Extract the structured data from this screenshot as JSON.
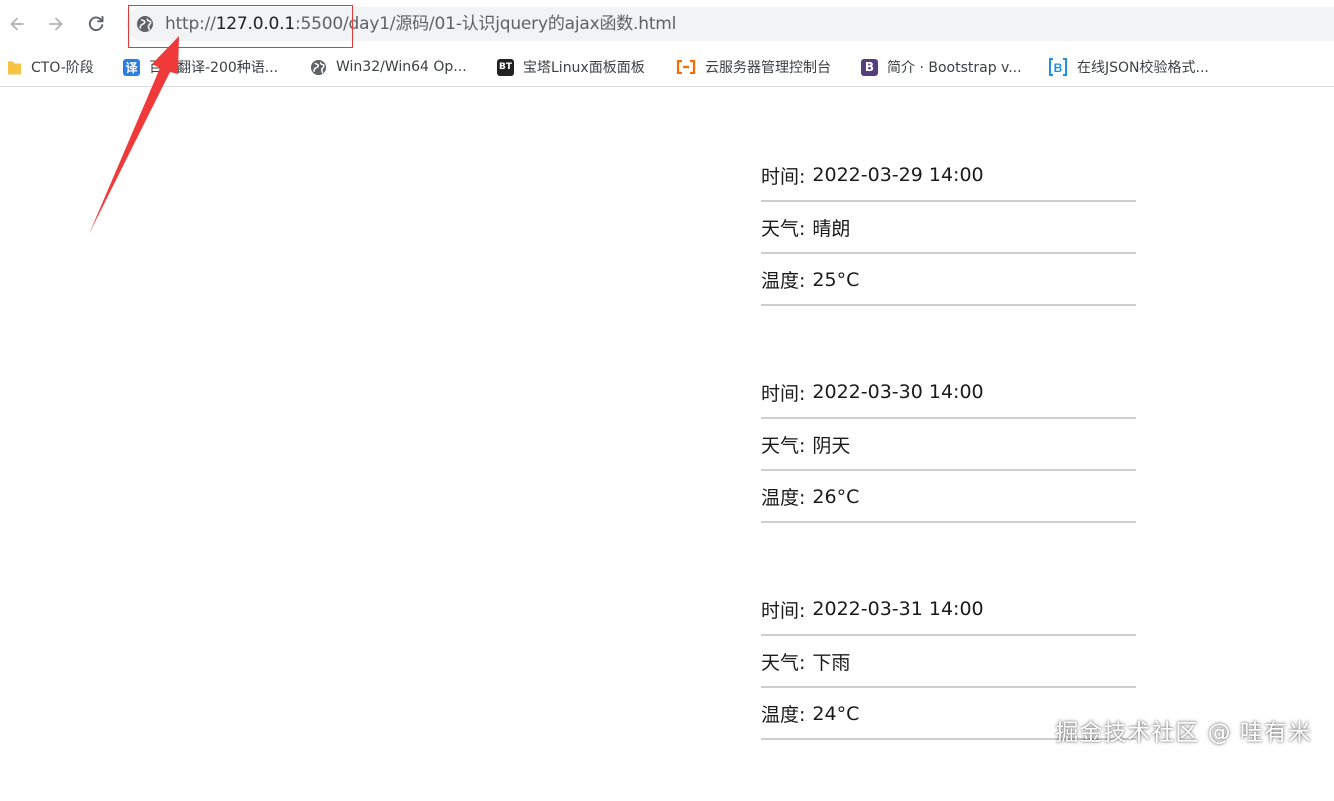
{
  "address_bar": {
    "url_scheme": "http://",
    "url_host": "127.0.0.1",
    "url_rest": ":5500/day1/源码/01-认识jquery的ajax函数.html"
  },
  "bookmarks": [
    {
      "label": "CTO-阶段",
      "icon": "folder-icon",
      "color": "#f6c344"
    },
    {
      "label": "百度翻译-200种语...",
      "icon": "translate-icon",
      "color": "#2a7de1"
    },
    {
      "label": "Win32/Win64 Op...",
      "icon": "globe-icon",
      "color": "#5f6368"
    },
    {
      "label": "宝塔Linux面板面板",
      "icon": "bt-icon",
      "color": "#222222"
    },
    {
      "label": "云服务器管理控制台",
      "icon": "aliyun-icon",
      "color": "#ff6a00"
    },
    {
      "label": "简介 · Bootstrap v...",
      "icon": "bootstrap-icon",
      "color": "#563d7c"
    },
    {
      "label": "在线JSON校验格式...",
      "icon": "json-icon",
      "color": "#1e90e6"
    }
  ],
  "weather": [
    {
      "time_label": "时间:",
      "time": "2022-03-29 14:00",
      "weather_label": "天气:",
      "weather": "晴朗",
      "temp_label": "温度:",
      "temp": "25°C"
    },
    {
      "time_label": "时间:",
      "time": "2022-03-30 14:00",
      "weather_label": "天气:",
      "weather": "阴天",
      "temp_label": "温度:",
      "temp": "26°C"
    },
    {
      "time_label": "时间:",
      "time": "2022-03-31 14:00",
      "weather_label": "天气:",
      "weather": "下雨",
      "temp_label": "温度:",
      "temp": "24°C"
    }
  ],
  "watermark": "掘金技术社区 @ 哇有米",
  "colors": {
    "annotation": "#f03a3a",
    "divider": "#cfcfcf"
  }
}
